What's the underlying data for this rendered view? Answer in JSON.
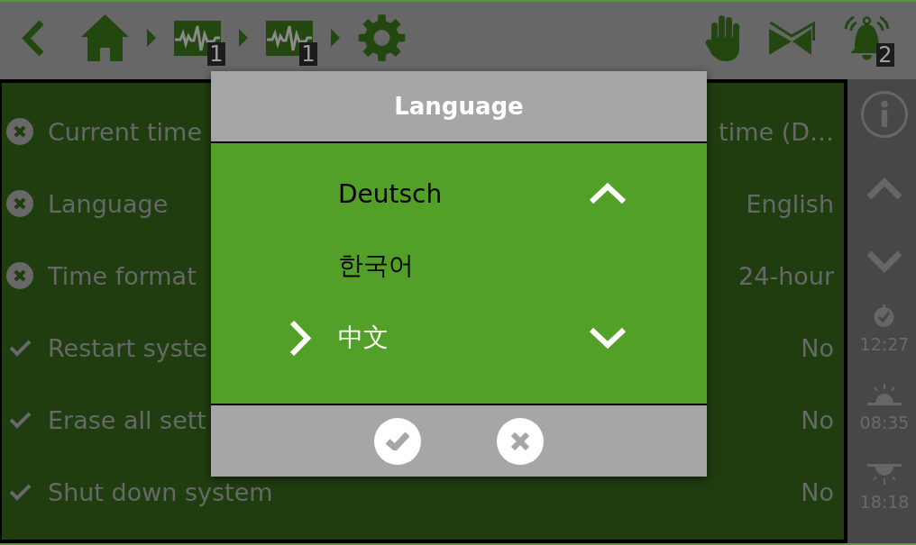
{
  "top_bar": {
    "breadcrumb": [
      {
        "kind": "home"
      },
      {
        "kind": "pulse",
        "badge": "1"
      },
      {
        "kind": "pulse",
        "badge": "1"
      },
      {
        "kind": "gear"
      }
    ],
    "actions": [
      {
        "kind": "hand"
      },
      {
        "kind": "valve"
      },
      {
        "kind": "bell",
        "badge": "2"
      }
    ]
  },
  "settings": [
    {
      "label": "Current time",
      "value": "time (D…",
      "checked": false
    },
    {
      "label": "Language",
      "value": "English",
      "checked": false
    },
    {
      "label": "Time format",
      "value": "24-hour",
      "checked": false
    },
    {
      "label": "Restart syste",
      "value": "No",
      "checked": true
    },
    {
      "label": "Erase all sett",
      "value": "No",
      "checked": true
    },
    {
      "label": "Shut down system",
      "value": "No",
      "checked": true
    }
  ],
  "sidebar": {
    "times": [
      {
        "kind": "clock",
        "time": "12:27"
      },
      {
        "kind": "sunrise",
        "time": "08:35"
      },
      {
        "kind": "sunset",
        "time": "18:18"
      }
    ]
  },
  "dialog": {
    "title": "Language",
    "options": [
      {
        "label": "Deutsch",
        "selected": false
      },
      {
        "label": "한국어",
        "selected": false
      },
      {
        "label": "中文",
        "selected": true
      }
    ]
  }
}
